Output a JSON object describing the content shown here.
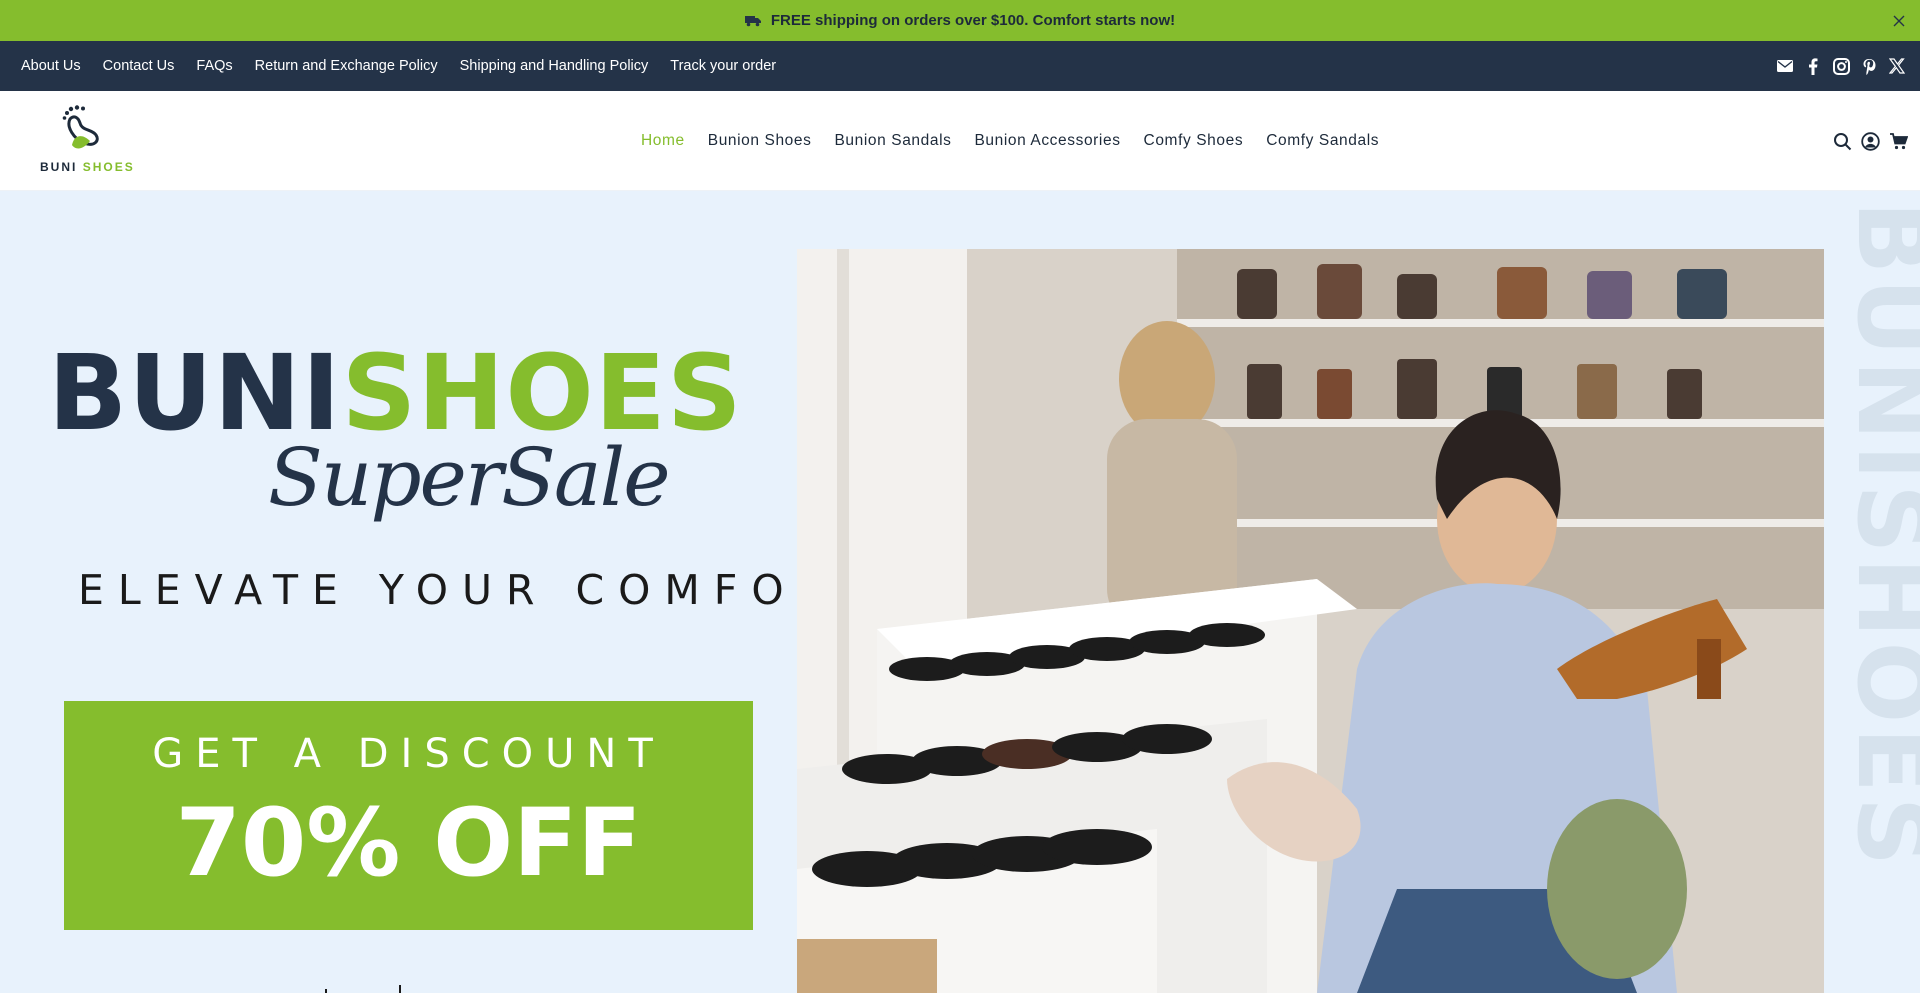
{
  "announcement": {
    "text": "FREE shipping on orders over $100. Comfort starts now!"
  },
  "topnav": {
    "links": [
      "About Us",
      "Contact Us",
      "FAQs",
      "Return and Exchange Policy",
      "Shipping and Handling Policy",
      "Track your order"
    ],
    "social_icons": [
      "mail-icon",
      "facebook-icon",
      "instagram-icon",
      "pinterest-icon",
      "x-icon"
    ]
  },
  "header": {
    "logo_text_dark": "BUNI",
    "logo_text_green": "SHOES",
    "nav": [
      "Home",
      "Bunion Shoes",
      "Bunion Sandals",
      "Bunion Accessories",
      "Comfy Shoes",
      "Comfy Sandals"
    ],
    "active_nav": "Home",
    "icons": [
      "search-icon",
      "account-icon",
      "cart-icon"
    ]
  },
  "hero": {
    "brand_dark": "BUNI",
    "brand_green": "SHOES",
    "script_title": "SuperSale",
    "tagline": "ELEVATE YOUR COMFORT",
    "discount_heading": "GET A DISCOUNT",
    "discount_value": "70% OFF",
    "vertical_text": "BUNISHOES"
  },
  "colors": {
    "accent_green": "#85bd2d",
    "navy": "#243348",
    "hero_bg": "#e8f2fc"
  }
}
